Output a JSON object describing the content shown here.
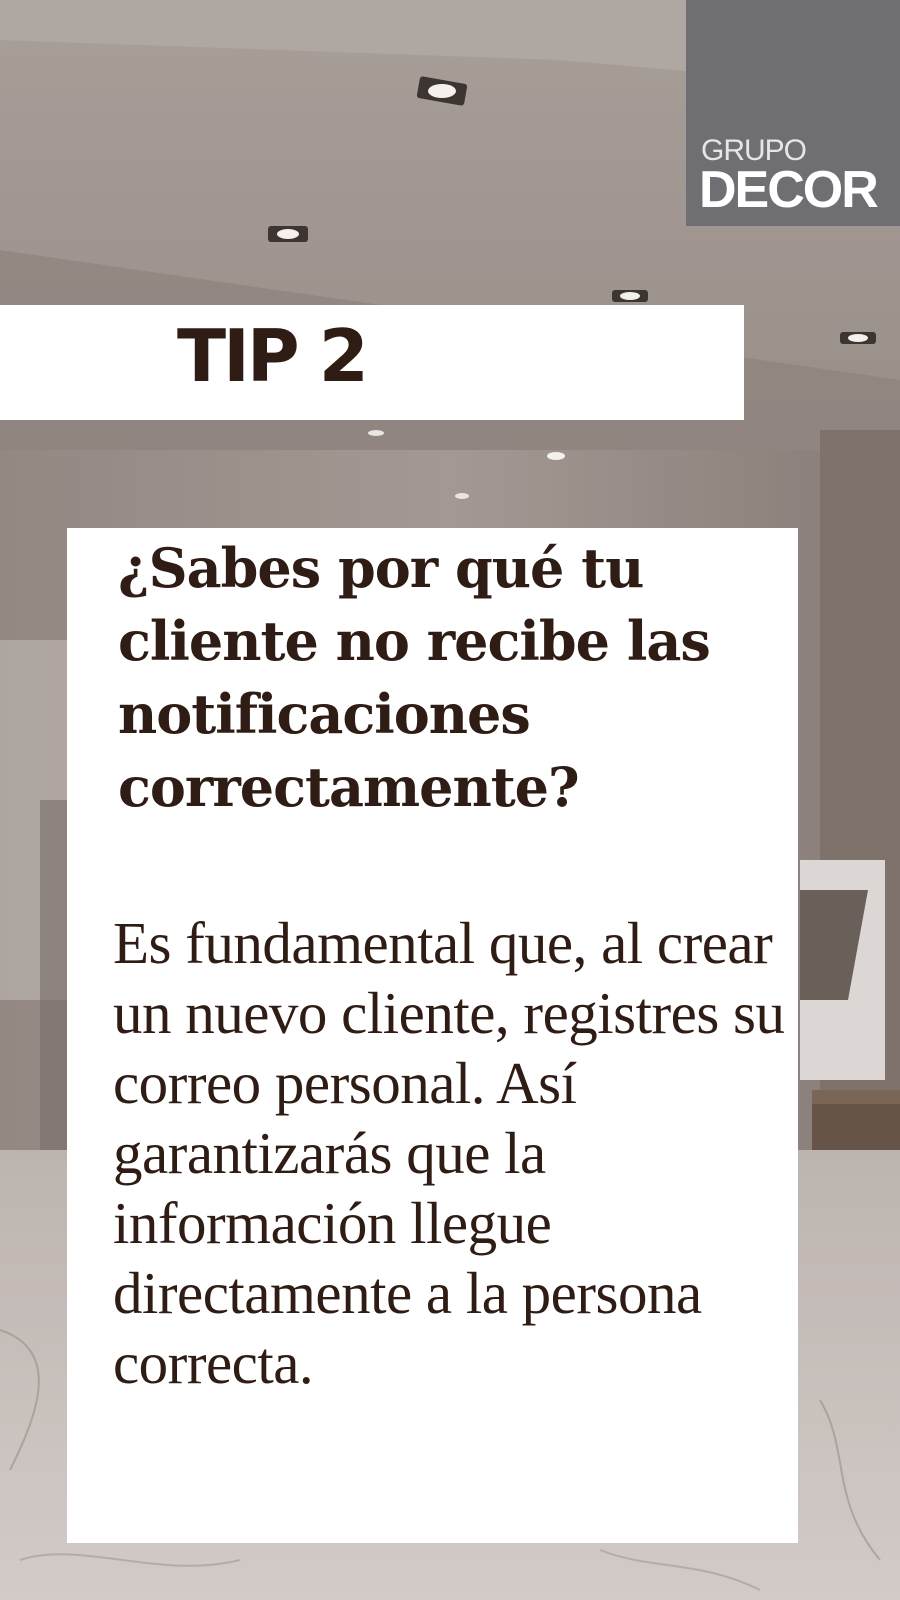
{
  "logo": {
    "top": "GRUPO",
    "main": "DECOR"
  },
  "tip": {
    "label": "TIP 2"
  },
  "card": {
    "question": "¿Sabes por qué tu cliente no recibe las notificaciones correctamente?",
    "answer": "Es fundamental que, al crear un nuevo cliente, registres su correo personal. Así garantizarás que la información llegue directamente a la persona correcta."
  },
  "colors": {
    "text_dark": "#2f1d15",
    "logo_bg": "#6e6e73",
    "panel_bg": "#ffffff",
    "photo_tone": "#8d8079"
  }
}
